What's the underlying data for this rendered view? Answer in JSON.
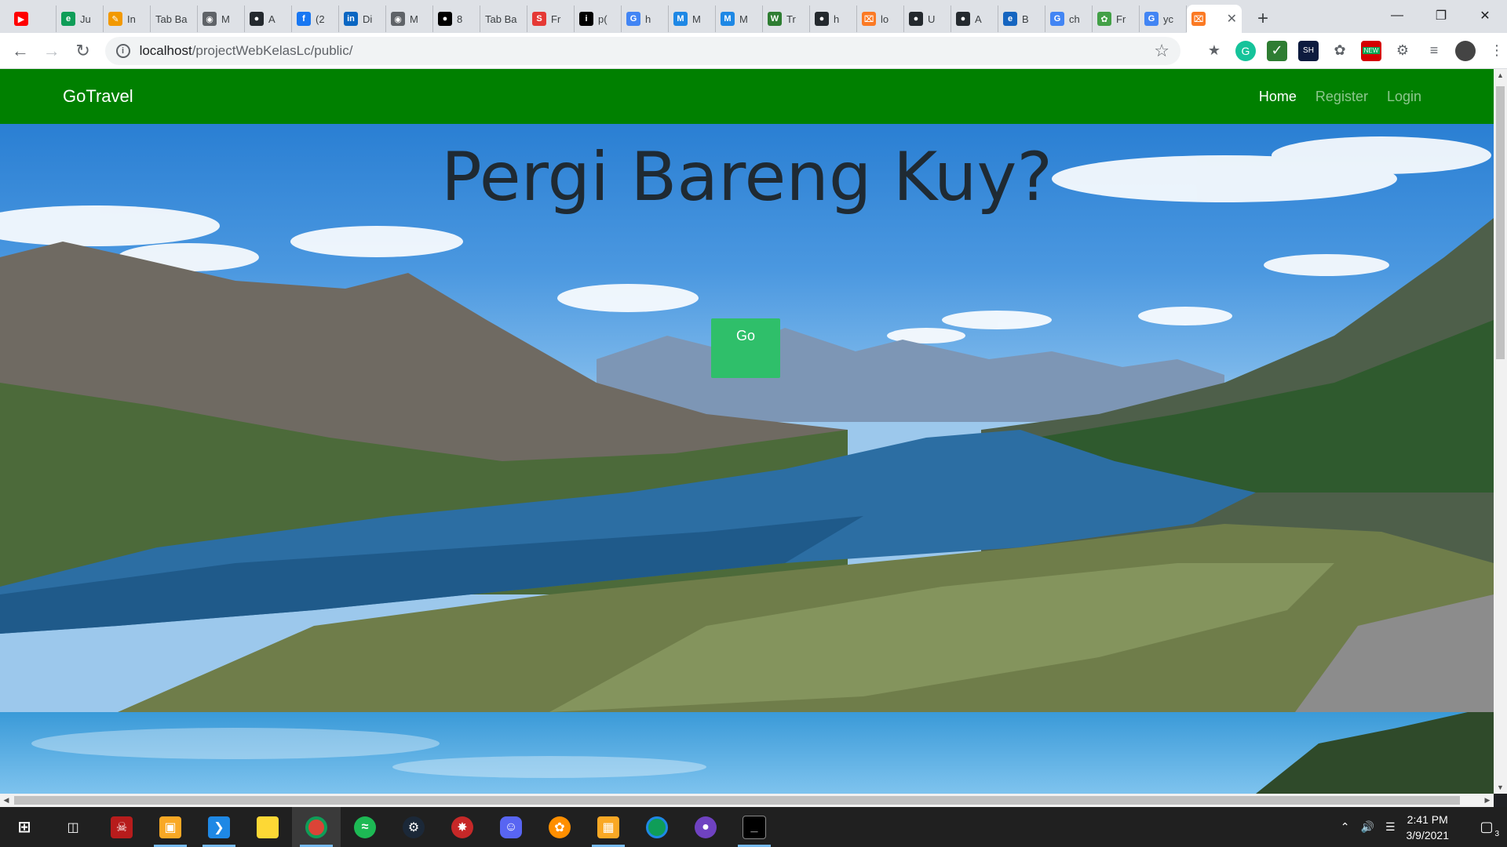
{
  "browser": {
    "tabs": [
      {
        "label": "",
        "icon": "youtube-icon",
        "color": "#ff0000"
      },
      {
        "label": "Ju",
        "icon": "edge-icon",
        "color": "#0f9d58"
      },
      {
        "label": "In",
        "icon": "pen-icon",
        "color": "#f29900"
      },
      {
        "label": "Tab Ba",
        "icon": "",
        "color": ""
      },
      {
        "label": "M",
        "icon": "globe-icon",
        "color": "#5f6368"
      },
      {
        "label": "A",
        "icon": "github-icon",
        "color": "#24292e"
      },
      {
        "label": "(2",
        "icon": "facebook-icon",
        "color": "#1877f2"
      },
      {
        "label": "Di",
        "icon": "linkedin-icon",
        "color": "#0a66c2"
      },
      {
        "label": "M",
        "icon": "globe-icon",
        "color": "#5f6368"
      },
      {
        "label": "8",
        "icon": "medium-icon",
        "color": "#000000"
      },
      {
        "label": "Tab Ba",
        "icon": "",
        "color": ""
      },
      {
        "label": "Fr",
        "icon": "s-icon",
        "color": "#e53935"
      },
      {
        "label": "p(",
        "icon": "info-icon",
        "color": "#000000"
      },
      {
        "label": "h",
        "icon": "google-icon",
        "color": "#4285f4"
      },
      {
        "label": "M",
        "icon": "m-icon",
        "color": "#1e88e5"
      },
      {
        "label": "M",
        "icon": "m-icon",
        "color": "#1e88e5"
      },
      {
        "label": "Tr",
        "icon": "w-icon",
        "color": "#2e7d32"
      },
      {
        "label": "h",
        "icon": "github-icon",
        "color": "#24292e"
      },
      {
        "label": "lo",
        "icon": "xampp-icon",
        "color": "#fb7a24"
      },
      {
        "label": "U",
        "icon": "github-icon",
        "color": "#24292e"
      },
      {
        "label": "A",
        "icon": "github-icon",
        "color": "#24292e"
      },
      {
        "label": "B",
        "icon": "edge-icon",
        "color": "#1565c0"
      },
      {
        "label": "ch",
        "icon": "google-icon",
        "color": "#4285f4"
      },
      {
        "label": "Fr",
        "icon": "leaf-icon",
        "color": "#43a047"
      },
      {
        "label": "yc",
        "icon": "google-icon",
        "color": "#4285f4"
      }
    ],
    "active_tab_icon": "xampp-icon",
    "url_host": "localhost",
    "url_path": "/projectWebKelasLc/public/",
    "extension_badge": "NEW"
  },
  "site": {
    "brand": "GoTravel",
    "nav": {
      "home": "Home",
      "register": "Register",
      "login": "Login"
    },
    "hero_title": "Pergi Bareng Kuy?",
    "cta": "Go",
    "navbar_color": "#008000",
    "button_color": "#2fbf6a"
  },
  "taskbar": {
    "time": "2:41 PM",
    "date": "3/9/2021",
    "notifications": "3"
  }
}
